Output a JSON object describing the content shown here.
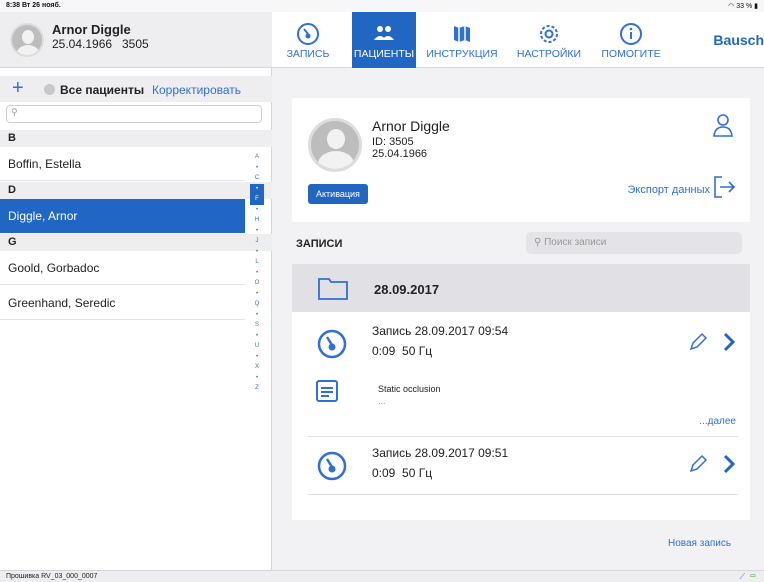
{
  "status_bar": {
    "time": "8:38 Вт 26 нояб.",
    "battery": "33 %"
  },
  "user": {
    "name": "Arnor Diggle",
    "dob": "25.04.1966",
    "id": "3505"
  },
  "patients_list": {
    "all_label": "Все пациенты",
    "edit_label": "Корректировать",
    "search_placeholder": "",
    "sections": [
      {
        "letter": "B",
        "rows": [
          "Boffin, Estella"
        ]
      },
      {
        "letter": "D",
        "rows": [
          "Diggle, Arnor"
        ]
      },
      {
        "letter": "G",
        "rows": [
          "Goold, Gorbadoc",
          "Greenhand, Seredic"
        ]
      }
    ],
    "selected": "Diggle, Arnor",
    "index_letters": [
      "A",
      "•",
      "C",
      "•",
      "F",
      "•",
      "H",
      "•",
      "J",
      "•",
      "L",
      "•",
      "O",
      "•",
      "Q",
      "•",
      "S",
      "•",
      "U",
      "•",
      "X",
      "•",
      "Z"
    ]
  },
  "nav": {
    "tabs": [
      {
        "label": "ЗАПИСЬ",
        "icon": "gauge-icon",
        "active": false
      },
      {
        "label": "ПАЦИЕНТЫ",
        "icon": "people-icon",
        "active": true
      },
      {
        "label": "ИНСТРУКЦИЯ",
        "icon": "map-icon",
        "active": false
      },
      {
        "label": "НАСТРОЙКИ",
        "icon": "gear-icon",
        "active": false
      },
      {
        "label": "ПОМОГИТЕ",
        "icon": "info-icon",
        "active": false
      }
    ],
    "brand": "Bausch"
  },
  "patient_card": {
    "name": "Arnor Diggle",
    "id": "ID: 3505",
    "dob": "25.04.1966",
    "activation_button": "Активация",
    "export_label": "Экспорт данных"
  },
  "records": {
    "title": "ЗАПИСИ",
    "search_placeholder": "Поиск записи",
    "folder_date": "28.09.2017",
    "items": [
      {
        "title": "Запись 28.09.2017 09:54",
        "duration": "0:09",
        "freq": "50 Гц"
      },
      {
        "title": "Запись 28.09.2017 09:51",
        "duration": "0:09",
        "freq": "50 Гц"
      }
    ],
    "note": {
      "text": "Static occlusion",
      "sub": "..."
    },
    "more_label": "...далее",
    "new_record": "Новая запись"
  },
  "bottom_bar": {
    "firmware": "Прошивка RV_03_000_0007"
  },
  "colors": {
    "accent": "#2266c4",
    "link": "#2f6fd6"
  }
}
